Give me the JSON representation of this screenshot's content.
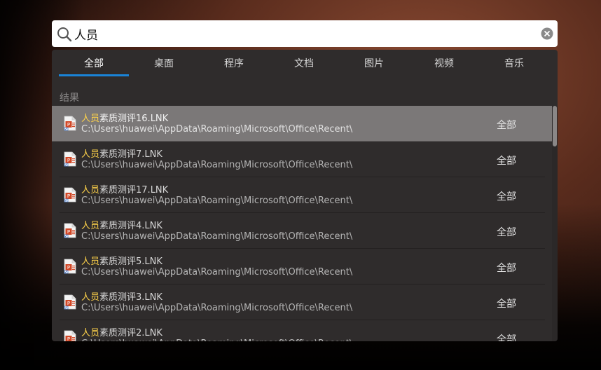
{
  "search": {
    "value": "人员",
    "placeholder": ""
  },
  "tabs": [
    {
      "label": "全部",
      "active": true
    },
    {
      "label": "桌面"
    },
    {
      "label": "程序"
    },
    {
      "label": "文档"
    },
    {
      "label": "图片"
    },
    {
      "label": "视频"
    },
    {
      "label": "音乐"
    }
  ],
  "section_label": "结果",
  "results": [
    {
      "highlight": "人员",
      "rest": "素质测评16.LNK",
      "path": "C:\\Users\\huawei\\AppData\\Roaming\\Microsoft\\Office\\Recent\\",
      "category": "全部",
      "icon": "powerpoint-shortcut-icon"
    },
    {
      "highlight": "人员",
      "rest": "素质测评7.LNK",
      "path": "C:\\Users\\huawei\\AppData\\Roaming\\Microsoft\\Office\\Recent\\",
      "category": "全部",
      "icon": "powerpoint-shortcut-icon"
    },
    {
      "highlight": "人员",
      "rest": "素质测评17.LNK",
      "path": "C:\\Users\\huawei\\AppData\\Roaming\\Microsoft\\Office\\Recent\\",
      "category": "全部",
      "icon": "powerpoint-shortcut-icon"
    },
    {
      "highlight": "人员",
      "rest": "素质测评4.LNK",
      "path": "C:\\Users\\huawei\\AppData\\Roaming\\Microsoft\\Office\\Recent\\",
      "category": "全部",
      "icon": "powerpoint-shortcut-icon"
    },
    {
      "highlight": "人员",
      "rest": "素质测评5.LNK",
      "path": "C:\\Users\\huawei\\AppData\\Roaming\\Microsoft\\Office\\Recent\\",
      "category": "全部",
      "icon": "powerpoint-shortcut-icon"
    },
    {
      "highlight": "人员",
      "rest": "素质测评3.LNK",
      "path": "C:\\Users\\huawei\\AppData\\Roaming\\Microsoft\\Office\\Recent\\",
      "category": "全部",
      "icon": "powerpoint-shortcut-icon"
    },
    {
      "highlight": "人员",
      "rest": "素质测评2.LNK",
      "path": "C:\\Users\\huawei\\AppData\\Roaming\\Microsoft\\Office\\Recent\\",
      "category": "全部",
      "icon": "powerpoint-shortcut-icon"
    }
  ],
  "colors": {
    "accent": "#1a84d8",
    "highlight": "#ffd34a",
    "panel": "#2f2c2c",
    "selected_row": "#7b7878"
  }
}
